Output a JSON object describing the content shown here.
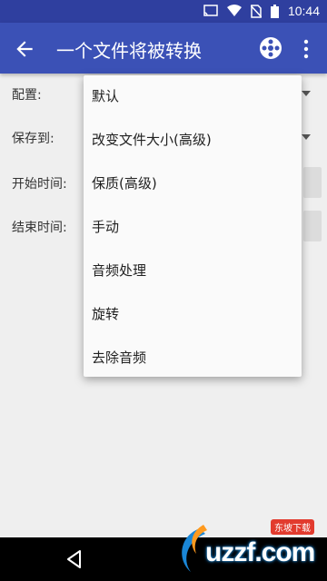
{
  "status_bar": {
    "time": "10:44",
    "icons": [
      "cast-icon",
      "wifi-icon",
      "no-sim-icon",
      "battery-icon"
    ]
  },
  "app_bar": {
    "title": "一个文件将被转换",
    "back_icon": "arrow-back-icon",
    "action_icon": "film-reel-icon",
    "overflow_icon": "more-vert-icon",
    "color": "#3b51b6"
  },
  "form": {
    "profile_label": "配置:",
    "save_to_label": "保存到:",
    "start_time_label": "开始时间:",
    "end_time_label": "结束时间:"
  },
  "menu": {
    "items": [
      {
        "label": "默认"
      },
      {
        "label": "改变文件大小(高级)"
      },
      {
        "label": "保质(高级)"
      },
      {
        "label": "手动"
      },
      {
        "label": "音频处理"
      },
      {
        "label": "旋转"
      },
      {
        "label": "去除音频"
      }
    ]
  },
  "watermark": {
    "text": "uzzf.com",
    "badge": "东坡下载"
  }
}
